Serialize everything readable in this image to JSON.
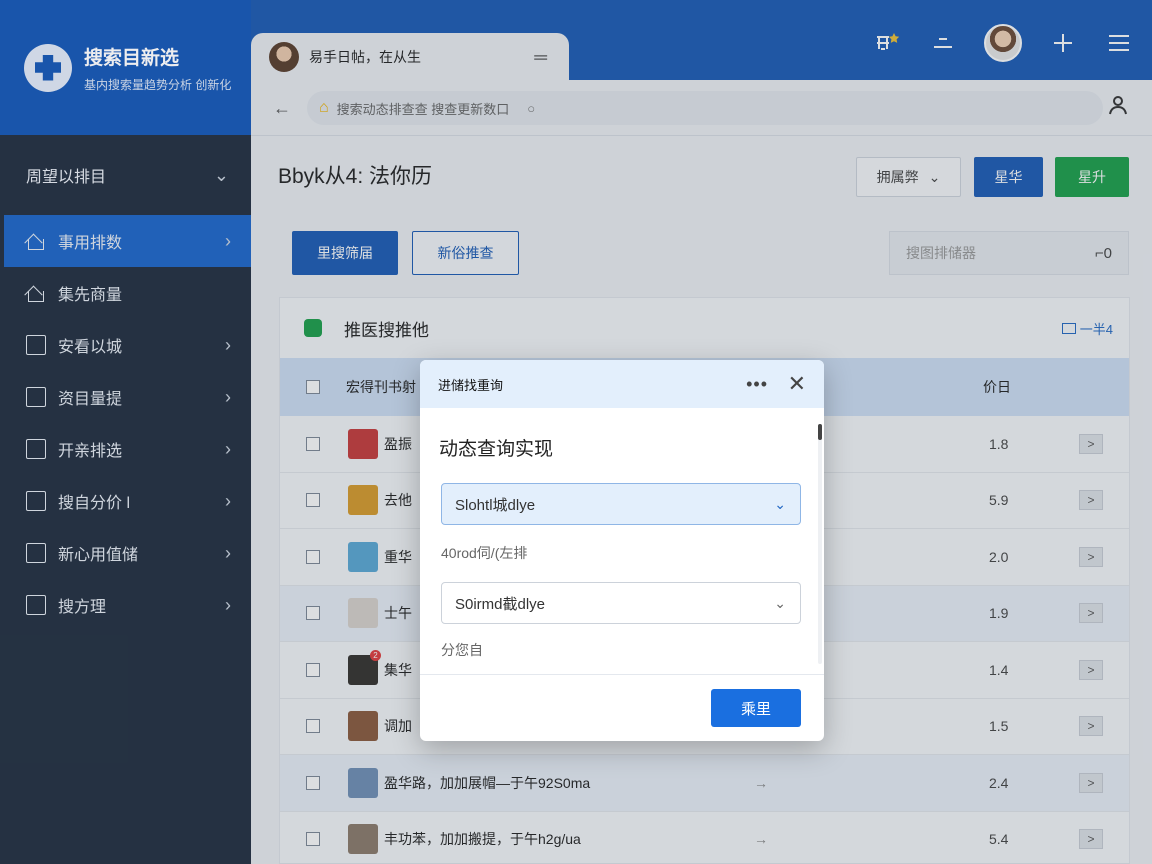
{
  "brand": {
    "title": "搜索目新选",
    "subtitle": "基内搜索量趋势分析 创新化"
  },
  "topbar": {
    "icons": [
      "premium-icon",
      "minimize-icon",
      "user-avatar",
      "add-icon",
      "menu-icon"
    ]
  },
  "tab": {
    "title": "易手日帖，在从生",
    "menu_icon": "menu-icon"
  },
  "address": {
    "text": "搜索动态排查查 搜查更新数口"
  },
  "sidebar": {
    "header": "周望以排目",
    "items": [
      {
        "label": "事用排数",
        "active": true
      },
      {
        "label": "集先商量",
        "active": false
      },
      {
        "label": "安看以城",
        "active": false
      },
      {
        "label": "资目量提",
        "active": false
      },
      {
        "label": "开亲排选",
        "active": false
      },
      {
        "label": "搜自分价 l",
        "active": false
      },
      {
        "label": "新心用值储",
        "active": false
      },
      {
        "label": "搜方理",
        "active": false
      }
    ]
  },
  "page": {
    "title": "Bbyk从4",
    "title_suffix": "法你历",
    "filter_label": "拥属弊",
    "blue_btn": "星华",
    "green_btn": "星升"
  },
  "toolbar": {
    "primary": "里搜筛届",
    "secondary": "新俗推查",
    "search_placeholder": "搜图排储器",
    "search_suffix": "⌐0"
  },
  "card": {
    "title": "推医搜推他",
    "link": "一半4"
  },
  "table": {
    "header_name": "宏得刊书射",
    "header_num": "价日",
    "rows": [
      {
        "name": "盈振",
        "num": "1.8",
        "thumb": "#c73a3a",
        "arrow": ""
      },
      {
        "name": "去他",
        "num": "5.9",
        "thumb": "#d89b2a",
        "arrow": ""
      },
      {
        "name": "重华",
        "num": "2.0",
        "thumb": "#5aa9d6",
        "arrow": ""
      },
      {
        "name": "士午",
        "num": "1.9",
        "thumb": "#d9d3cd",
        "arrow": ""
      },
      {
        "name": "集华",
        "num": "1.4",
        "thumb": "#33302c",
        "arrow": ""
      },
      {
        "name": "调加",
        "num": "1.5",
        "thumb": "#8a5a3c",
        "arrow": ""
      },
      {
        "name": "盈华路，加加展帽—于午92S0ma",
        "num": "2.4",
        "thumb": "#6f8fb6",
        "arrow": "→"
      },
      {
        "name": "丰功苯，加加搬提，于午h2g/ua",
        "num": "5.4",
        "thumb": "#8b7a6b",
        "arrow": "→"
      }
    ],
    "go_label": ">"
  },
  "modal": {
    "header": "进储找重询",
    "title": "动态查询实现",
    "select1_value": "Slohtl城dlye",
    "label1": "40rod伺/(左排",
    "select2_value": "S0irmd截dlye",
    "label2": "分您自",
    "ok_label": "乘里"
  }
}
